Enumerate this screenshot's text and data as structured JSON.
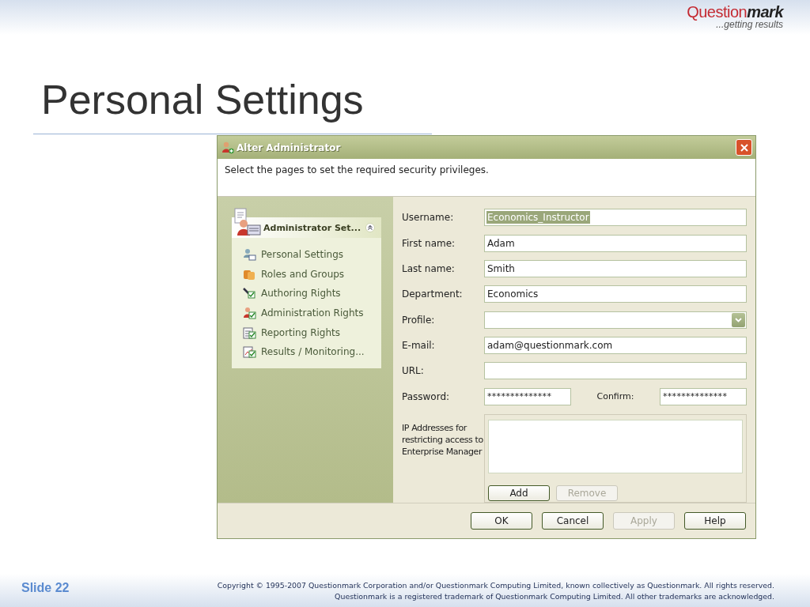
{
  "slide": {
    "logo": {
      "word_start": "Question",
      "word_end": "mark",
      "tagline": "...getting results"
    },
    "title": "Personal Settings"
  },
  "dialog": {
    "title": "Alter Administrator",
    "instruction": "Select the pages to set the required security privileges.",
    "task_pane": {
      "header": "Administrator Set...",
      "expanded": true,
      "items": [
        {
          "label": "Personal Settings"
        },
        {
          "label": "Roles and Groups"
        },
        {
          "label": "Authoring Rights"
        },
        {
          "label": "Administration Rights"
        },
        {
          "label": "Reporting Rights"
        },
        {
          "label": "Results / Monitoring..."
        }
      ]
    },
    "fields": [
      {
        "kind": "text",
        "label": "Username:",
        "value": "Economics_Instructor",
        "highlighted": true
      },
      {
        "kind": "text",
        "label": "First name:",
        "value": "Adam",
        "highlighted": false
      },
      {
        "kind": "text",
        "label": "Last name:",
        "value": "Smith",
        "highlighted": false
      },
      {
        "kind": "text",
        "label": "Department:",
        "value": "Economics",
        "highlighted": false
      },
      {
        "kind": "dropdown",
        "label": "Profile:"
      },
      {
        "kind": "text",
        "label": "E-mail:",
        "value": "adam@questionmark.com",
        "highlighted": false
      },
      {
        "kind": "text",
        "label": "URL:"
      },
      {
        "kind": "password",
        "label": "Password:",
        "value": "**************",
        "confirm_label": "Confirm:",
        "confirm_value": "**************"
      }
    ],
    "ip_section": {
      "label": "IP Addresses for restricting access to Enterprise Manager",
      "buttons": [
        {
          "label": "Add",
          "disabled": false
        },
        {
          "label": "Remove",
          "disabled": true
        }
      ]
    },
    "buttons": [
      {
        "label": "OK",
        "disabled": false
      },
      {
        "label": "Cancel",
        "disabled": false
      },
      {
        "label": "Apply",
        "disabled": true
      },
      {
        "label": "Help",
        "disabled": false
      }
    ]
  },
  "footer": {
    "slide_number": "Slide 22",
    "copyright": [
      "Copyright © 1995-2007 Questionmark Corporation and/or Questionmark Computing Limited, known collectively as Questionmark. All rights reserved.",
      "Questionmark is a registered trademark of Questionmark Computing Limited. All other trademarks are acknowledged."
    ]
  }
}
